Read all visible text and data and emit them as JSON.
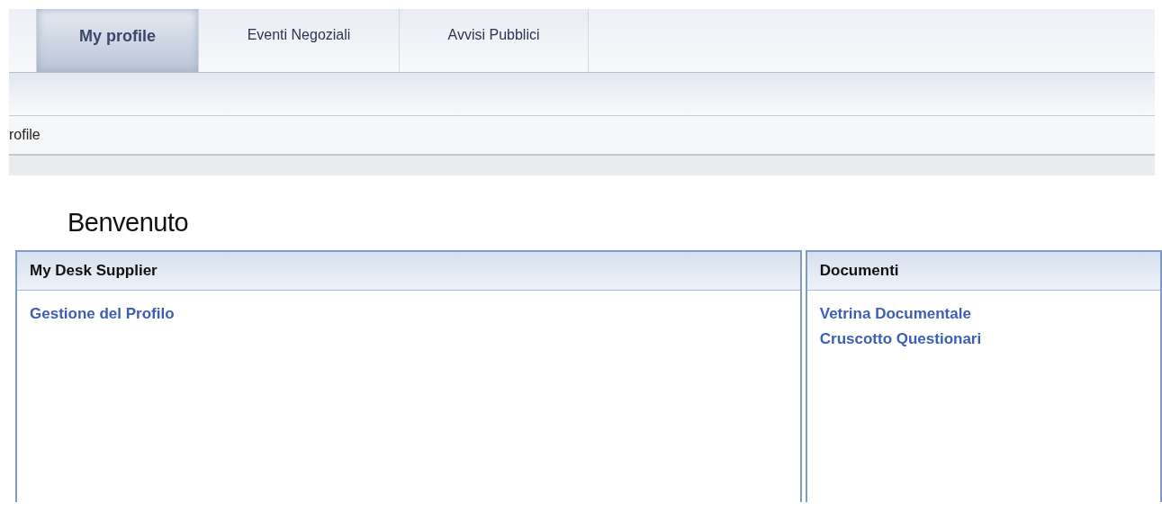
{
  "tabs": [
    {
      "label": "My profile",
      "selected": true
    },
    {
      "label": "Eventi Negoziali",
      "selected": false
    },
    {
      "label": "Avvisi Pubblici",
      "selected": false
    }
  ],
  "breadcrumb": "rofile",
  "welcome": "Benvenuto",
  "panels": [
    {
      "title": "My Desk Supplier",
      "links": [
        "Gestione del Profilo"
      ]
    },
    {
      "title": "Documenti",
      "links": [
        "Vetrina Documentale",
        "Cruscotto Questionari"
      ]
    }
  ]
}
